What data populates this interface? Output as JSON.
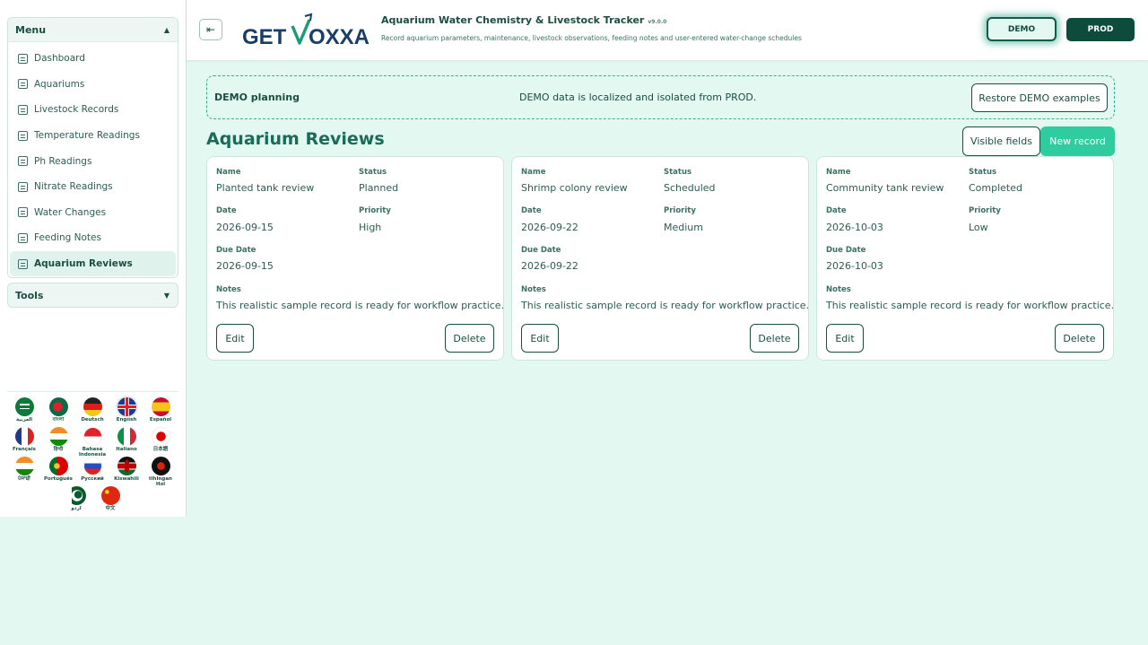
{
  "sidebar": {
    "menu_title": "Menu",
    "tools_title": "Tools",
    "items": [
      {
        "label": "Dashboard"
      },
      {
        "label": "Aquariums"
      },
      {
        "label": "Livestock Records"
      },
      {
        "label": "Temperature Readings"
      },
      {
        "label": "Ph Readings"
      },
      {
        "label": "Nitrate Readings"
      },
      {
        "label": "Water Changes"
      },
      {
        "label": "Feeding Notes"
      },
      {
        "label": "Aquarium Reviews",
        "active": true
      }
    ],
    "languages": [
      {
        "label": "العربية"
      },
      {
        "label": "বাংলা"
      },
      {
        "label": "Deutsch"
      },
      {
        "label": "English",
        "selected": true
      },
      {
        "label": "Español"
      },
      {
        "label": "Français"
      },
      {
        "label": "हिन्दी"
      },
      {
        "label": "Bahasa Indonesia"
      },
      {
        "label": "Italiano"
      },
      {
        "label": "日本語"
      },
      {
        "label": "ਪੰਜਾਬੀ"
      },
      {
        "label": "Português"
      },
      {
        "label": "Русский"
      },
      {
        "label": "Kiswahili"
      },
      {
        "label": "tlhIngan Hol"
      },
      {
        "label": "اردو"
      },
      {
        "label": "中文"
      }
    ]
  },
  "header": {
    "logo_text_left": "GET",
    "logo_text_right": "OXXA",
    "title": "Aquarium Water Chemistry & Livestock Tracker",
    "version": "v9.0.0",
    "subtitle": "Record aquarium parameters, maintenance, livestock observations, feeding notes and user-entered water-change schedules",
    "demo_label": "DEMO",
    "prod_label": "PROD"
  },
  "banner": {
    "title": "DEMO planning",
    "text": "DEMO data is localized and isolated from PROD.",
    "restore_label": "Restore DEMO examples"
  },
  "section": {
    "title": "Aquarium Reviews",
    "visible_fields_label": "Visible fields",
    "new_record_label": "New record"
  },
  "field_labels": {
    "name": "Name",
    "status": "Status",
    "date": "Date",
    "priority": "Priority",
    "due_date": "Due Date",
    "notes": "Notes"
  },
  "actions": {
    "edit": "Edit",
    "delete": "Delete"
  },
  "records": [
    {
      "name": "Planted tank review",
      "status": "Planned",
      "date": "2026-09-15",
      "priority": "High",
      "due_date": "2026-09-15",
      "notes": "This realistic sample record is ready for workflow practice."
    },
    {
      "name": "Shrimp colony review",
      "status": "Scheduled",
      "date": "2026-09-22",
      "priority": "Medium",
      "due_date": "2026-09-22",
      "notes": "This realistic sample record is ready for workflow practice."
    },
    {
      "name": "Community tank review",
      "status": "Completed",
      "date": "2026-10-03",
      "priority": "Low",
      "due_date": "2026-10-03",
      "notes": "This realistic sample record is ready for workflow practice."
    }
  ],
  "colors": {
    "accent": "#2ecc9e",
    "dark": "#0d4c3c",
    "background": "#e2f8f1"
  }
}
